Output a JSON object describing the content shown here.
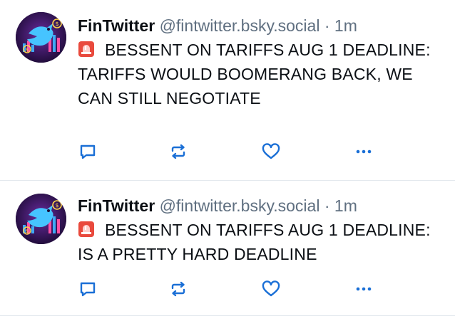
{
  "posts": [
    {
      "author_name": "FinTwitter",
      "author_handle": "@fintwitter.bsky.social",
      "separator": "·",
      "time": "1m",
      "text": "BESSENT ON TARIFFS AUG 1 DEADLINE: TARIFFS WOULD BOOMERANG BACK, WE CAN STILL NEGOTIATE",
      "emoji": "siren-icon"
    },
    {
      "author_name": "FinTwitter",
      "author_handle": "@fintwitter.bsky.social",
      "separator": "·",
      "time": "1m",
      "text": "BESSENT ON TARIFFS AUG 1 DEADLINE: IS A PRETTY HARD DEADLINE",
      "emoji": "siren-icon"
    }
  ],
  "actions": [
    "reply-icon",
    "repost-icon",
    "like-icon",
    "more-icon"
  ],
  "colors": {
    "icon": "#1a6fd6",
    "handle": "#5f6f80",
    "text": "#0b0f14",
    "divider": "#e3e8ee"
  }
}
